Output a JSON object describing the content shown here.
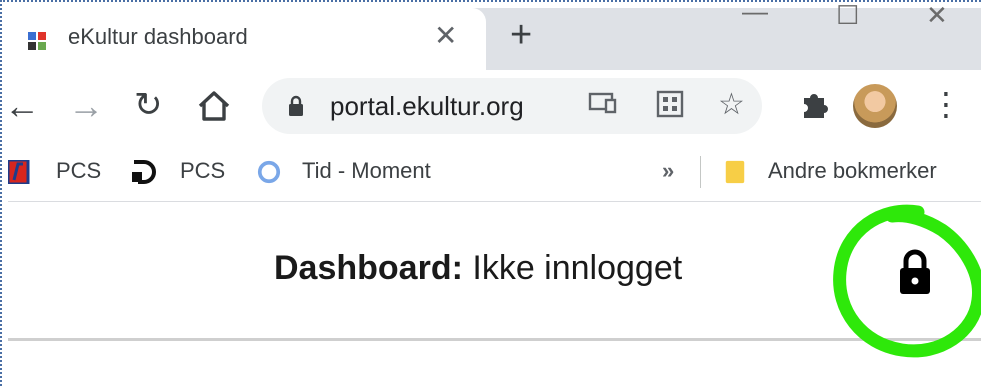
{
  "browser": {
    "tab": {
      "title": "eKultur dashboard",
      "close_icon": "close-icon",
      "favicon": "ekultur-favicon"
    },
    "new_tab_icon": "plus-icon",
    "window_controls": [
      "minimize-icon",
      "maximize-icon",
      "close-window-icon"
    ],
    "toolbar": {
      "back_icon": "back-arrow-icon",
      "forward_icon": "forward-arrow-icon",
      "reload_icon": "reload-icon",
      "home_icon": "home-icon",
      "url": "portal.ekultur.org",
      "extensions_icon": "puzzle-icon",
      "menu_icon": "kebab-menu-icon"
    },
    "bookmarks": [
      {
        "label": "PCS",
        "icon": "pcs-red-icon"
      },
      {
        "label": "PCS",
        "icon": "pcs-d-logo-icon"
      },
      {
        "label": "Tid - Moment",
        "icon": "moment-ring-icon"
      }
    ],
    "bookmarks_overflow": "»",
    "other_bookmarks": "Andre bokmerker"
  },
  "page": {
    "title_bold": "Dashboard:",
    "title_status": "Ikke innlogget",
    "lock_icon": "lock-icon",
    "annotation_color": "#2ee80a"
  }
}
